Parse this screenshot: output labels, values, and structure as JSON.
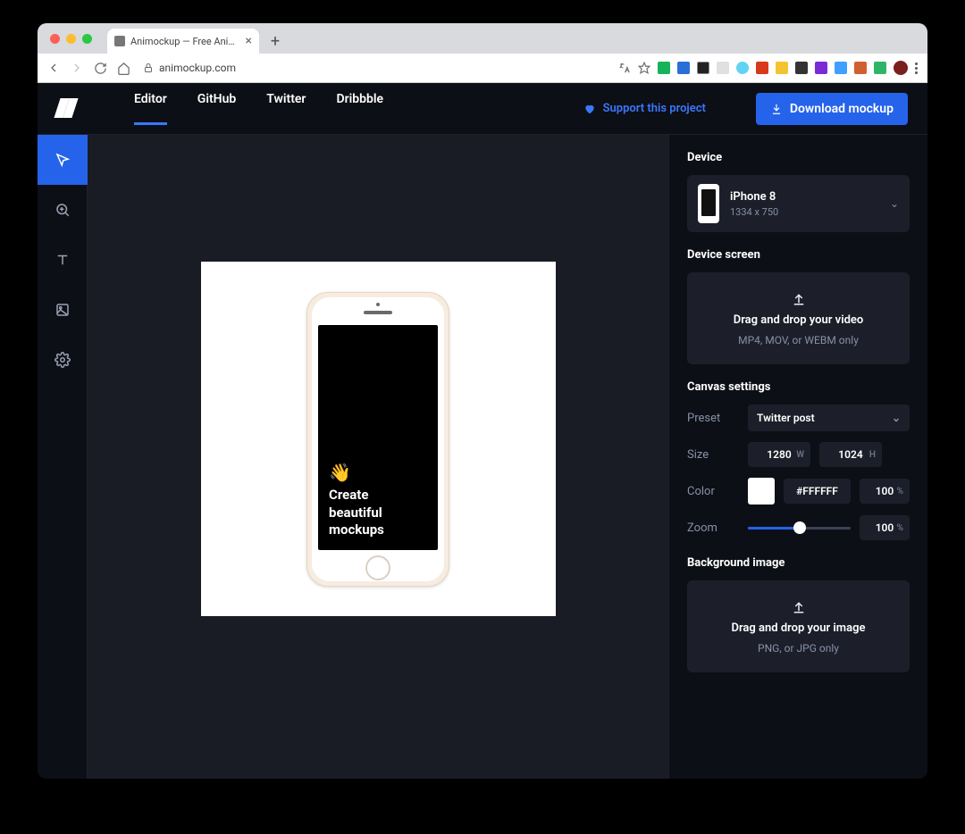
{
  "browser": {
    "tab_title": "Animockup — Free Animated Mo",
    "url_host": "animockup.com"
  },
  "header": {
    "nav": {
      "editor": "Editor",
      "github": "GitHub",
      "twitter": "Twitter",
      "dribbble": "Dribbble"
    },
    "support": "Support this project",
    "download": "Download mockup"
  },
  "canvas": {
    "screen_emoji": "👋",
    "screen_line1": "Create",
    "screen_line2": "beautiful",
    "screen_line3": "mockups"
  },
  "panel": {
    "device_heading": "Device",
    "device_name": "iPhone 8",
    "device_dims": "1334 x 750",
    "device_screen_heading": "Device screen",
    "video_drop_title": "Drag and drop your video",
    "video_drop_sub": "MP4, MOV, or WEBM only",
    "canvas_heading": "Canvas settings",
    "preset_label": "Preset",
    "preset_value": "Twitter post",
    "size_label": "Size",
    "size_w": "1280",
    "size_w_unit": "W",
    "size_h": "1024",
    "size_h_unit": "H",
    "color_label": "Color",
    "color_hex": "#FFFFFF",
    "color_opacity": "100",
    "pct": "%",
    "zoom_label": "Zoom",
    "zoom_value": "100",
    "bg_heading": "Background image",
    "image_drop_title": "Drag and drop your image",
    "image_drop_sub": "PNG, or JPG only"
  }
}
